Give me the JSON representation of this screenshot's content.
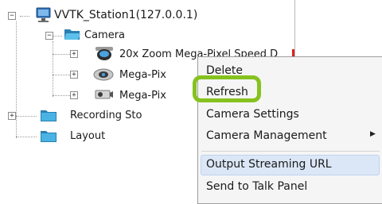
{
  "tree": {
    "root": {
      "label": "VVTK_Station1(127.0.0.1)",
      "icon": "computer-icon",
      "toggle": "−"
    },
    "camera_group": {
      "label": "Camera",
      "icon": "folder-open-icon",
      "toggle": "−"
    },
    "cameras": [
      {
        "label": "20x Zoom Mega-Pixel Speed D",
        "icon": "speed-dome-camera-icon",
        "toggle": "+"
      },
      {
        "label": "Mega-Pix",
        "icon": "dome-camera-icon",
        "toggle": "+"
      },
      {
        "label": "Mega-Pix",
        "icon": "box-camera-icon",
        "toggle": "+"
      }
    ],
    "recording": {
      "label": "Recording Sto",
      "icon": "folder-icon",
      "toggle": "+"
    },
    "layout": {
      "label": "Layout",
      "icon": "folder-icon"
    }
  },
  "context_menu": {
    "items": [
      {
        "label": "Delete"
      },
      {
        "label": "Refresh"
      },
      {
        "label": "Camera Settings"
      },
      {
        "label": "Camera Management",
        "submenu_arrow": "▶"
      },
      {
        "label": "Output Streaming URL"
      },
      {
        "label": "Send to Talk Panel"
      }
    ],
    "highlighted_item": "Refresh",
    "hovered_item": "Output Streaming URL"
  },
  "colors": {
    "highlight_ring": "#86c21f",
    "hover_bg": "#dbe7f7",
    "folder": "#3aa6d8"
  }
}
